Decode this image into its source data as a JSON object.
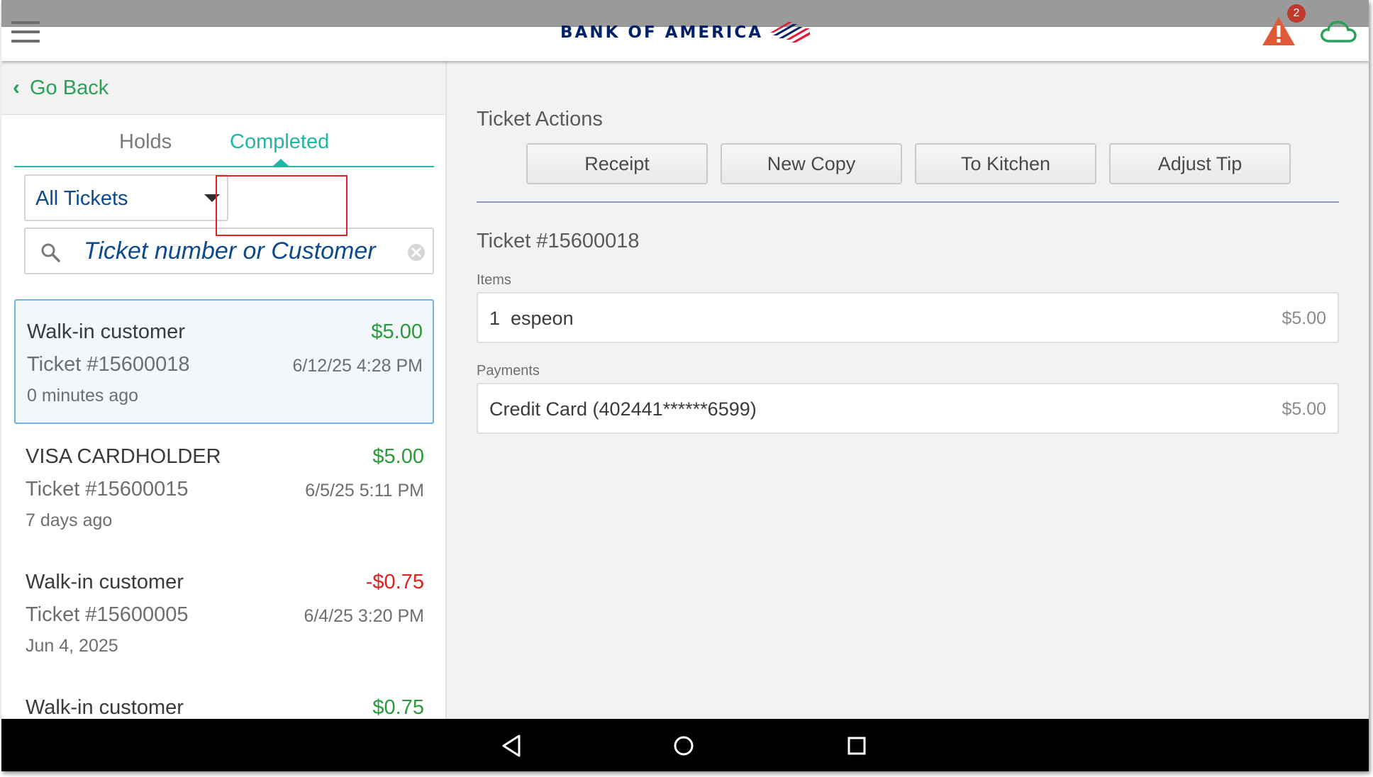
{
  "header": {
    "brand": "BANK OF AMERICA",
    "alert_count": "2",
    "brand_color": "#012169",
    "alert_color": "#e05a3a",
    "cloud_color": "#2aa15a"
  },
  "left": {
    "go_back_label": "Go Back",
    "tabs": [
      {
        "label": "Holds",
        "active": false
      },
      {
        "label": "Completed",
        "active": true
      }
    ],
    "filter": {
      "selected": "All Tickets"
    },
    "search": {
      "placeholder": "Ticket number or Customer",
      "value": ""
    },
    "tickets": [
      {
        "customer": "Walk-in customer",
        "amount": "$5.00",
        "amount_color": "#2a9a3a",
        "ticket": "Ticket #15600018",
        "datetime": "6/12/25 4:28 PM",
        "ago": "0 minutes ago",
        "selected": true
      },
      {
        "customer": "VISA CARDHOLDER",
        "amount": "$5.00",
        "amount_color": "#2a9a3a",
        "ticket": "Ticket #15600015",
        "datetime": "6/5/25 5:11 PM",
        "ago": "7 days ago",
        "selected": false
      },
      {
        "customer": "Walk-in customer",
        "amount": "-$0.75",
        "amount_color": "#e0201f",
        "ticket": "Ticket #15600005",
        "datetime": "6/4/25 3:20 PM",
        "ago": "Jun 4, 2025",
        "selected": false
      },
      {
        "customer": "Walk-in customer",
        "amount": "$0.75",
        "amount_color": "#2a9a3a",
        "ticket": "",
        "datetime": "",
        "ago": "",
        "selected": false
      }
    ]
  },
  "right": {
    "actions_title": "Ticket Actions",
    "actions": [
      "Receipt",
      "New Copy",
      "To Kitchen",
      "Adjust Tip"
    ],
    "ticket_title": "Ticket #15600018",
    "items_label": "Items",
    "items": [
      {
        "qty": "1",
        "name": "espeon",
        "price": "$5.00"
      }
    ],
    "payments_label": "Payments",
    "payments": [
      {
        "description": "Credit Card (402441******6599)",
        "amount": "$5.00"
      }
    ]
  },
  "navigation": {
    "buttons": [
      "back-icon",
      "home-icon",
      "recents-icon"
    ]
  }
}
